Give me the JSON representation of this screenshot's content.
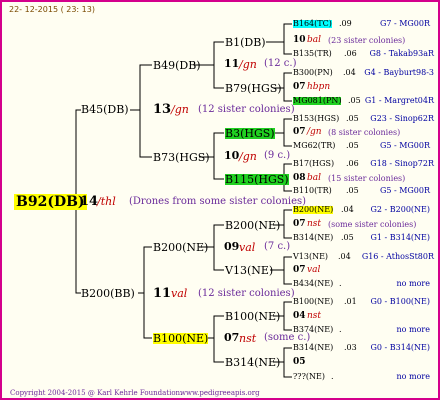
{
  "date": "22- 12-2015 ( 23: 13)",
  "footer": {
    "copyright": "Copyright 2004-2015 @ Karl Kehrle Foundation.",
    "url": "www.pedigreeapis.org"
  },
  "colors": {
    "border": "#d4008c",
    "note": "#6a2a9a",
    "red": "#c00000",
    "blue": "#0000a0",
    "cyan": "#00ffff",
    "green": "#20d020",
    "yellow": "#ffff00"
  },
  "root": {
    "id": "B92(DB)",
    "num": "14",
    "name": "/thl",
    "note": "(Drones from some sister colonies)"
  },
  "g1": [
    {
      "id": "B45(DB)",
      "num": "13",
      "name": "/gn",
      "note": "(12 sister colonies)"
    },
    {
      "id": "B200(BB)",
      "num": "11",
      "name": "val",
      "note": "(12 sister colonies)"
    }
  ],
  "g2": [
    {
      "id": "B49(DB)",
      "num": "11",
      "name": "/gn",
      "note": "(12 c.)"
    },
    {
      "id": "B73(HGS)",
      "num": "10",
      "name": "/gn",
      "note": "(9 c.)"
    },
    {
      "id": "B200(NE)",
      "num": "09",
      "name": "val",
      "note": "(7 c.)"
    },
    {
      "id": "B100(NE)",
      "num": "07",
      "name": "nst",
      "note": "(some c.)"
    }
  ],
  "g3": [
    {
      "id": "B1(DB)",
      "num": "10",
      "name": "bal",
      "note": "(23 sister colonies)"
    },
    {
      "id": "B79(HGS)",
      "num": "07",
      "name": "hbpn",
      "note": ""
    },
    {
      "id": "B3(HGS)",
      "num": "07",
      "name": "/gn",
      "note": "(8 sister colonies)"
    },
    {
      "id": "B115(HGS)",
      "num": "08",
      "name": "bal",
      "note": "(15 sister colonies)"
    },
    {
      "id": "B200(NE)",
      "num": "07",
      "name": "nst",
      "note": "(some sister colonies)"
    },
    {
      "id": "V13(NE)",
      "num": "07",
      "name": "val",
      "note": ""
    },
    {
      "id": "B100(NE)",
      "num": "04",
      "name": "nst",
      "note": ""
    },
    {
      "id": "B314(NE)",
      "num": "05",
      "name": "",
      "note": ""
    }
  ],
  "g4": [
    {
      "id": "B164(TC)",
      "val": ".09",
      "right": "G7 - MG00R"
    },
    {
      "id": "B135(TR)",
      "val": ".06",
      "right": "G8 - Takab93aR"
    },
    {
      "id": "B300(PN)",
      "val": ".04",
      "right": "G4 - Bayburt98-3"
    },
    {
      "id": "MG081(PN)",
      "val": ".05",
      "right": "G1 - Margret04R"
    },
    {
      "id": "B153(HGS)",
      "val": ".05",
      "right": "G23 - Sinop62R"
    },
    {
      "id": "MG62(TR)",
      "val": ".05",
      "right": "G5 - MG00R"
    },
    {
      "id": "B17(HGS)",
      "val": ".06",
      "right": "G18 - Sinop72R"
    },
    {
      "id": "B110(TR)",
      "val": ".05",
      "right": "G5 - MG00R"
    },
    {
      "id": "B200(NE)",
      "val": ".04",
      "right": "G2 - B200(NE)"
    },
    {
      "id": "B314(NE)",
      "val": ".05",
      "right": "G1 - B314(NE)"
    },
    {
      "id": "V13(NE)",
      "val": ".04",
      "right": "G16 - AthosSt80R"
    },
    {
      "id": "B434(NE)",
      "val": ".",
      "right": "no more"
    },
    {
      "id": "B100(NE)",
      "val": ".01",
      "right": "G0 - B100(NE)"
    },
    {
      "id": "B374(NE)",
      "val": ".",
      "right": "no more"
    },
    {
      "id": "B314(NE)",
      "val": ".03",
      "right": "G0 - B314(NE)"
    },
    {
      "id": "???(NE)",
      "val": ".",
      "right": "no more"
    }
  ]
}
